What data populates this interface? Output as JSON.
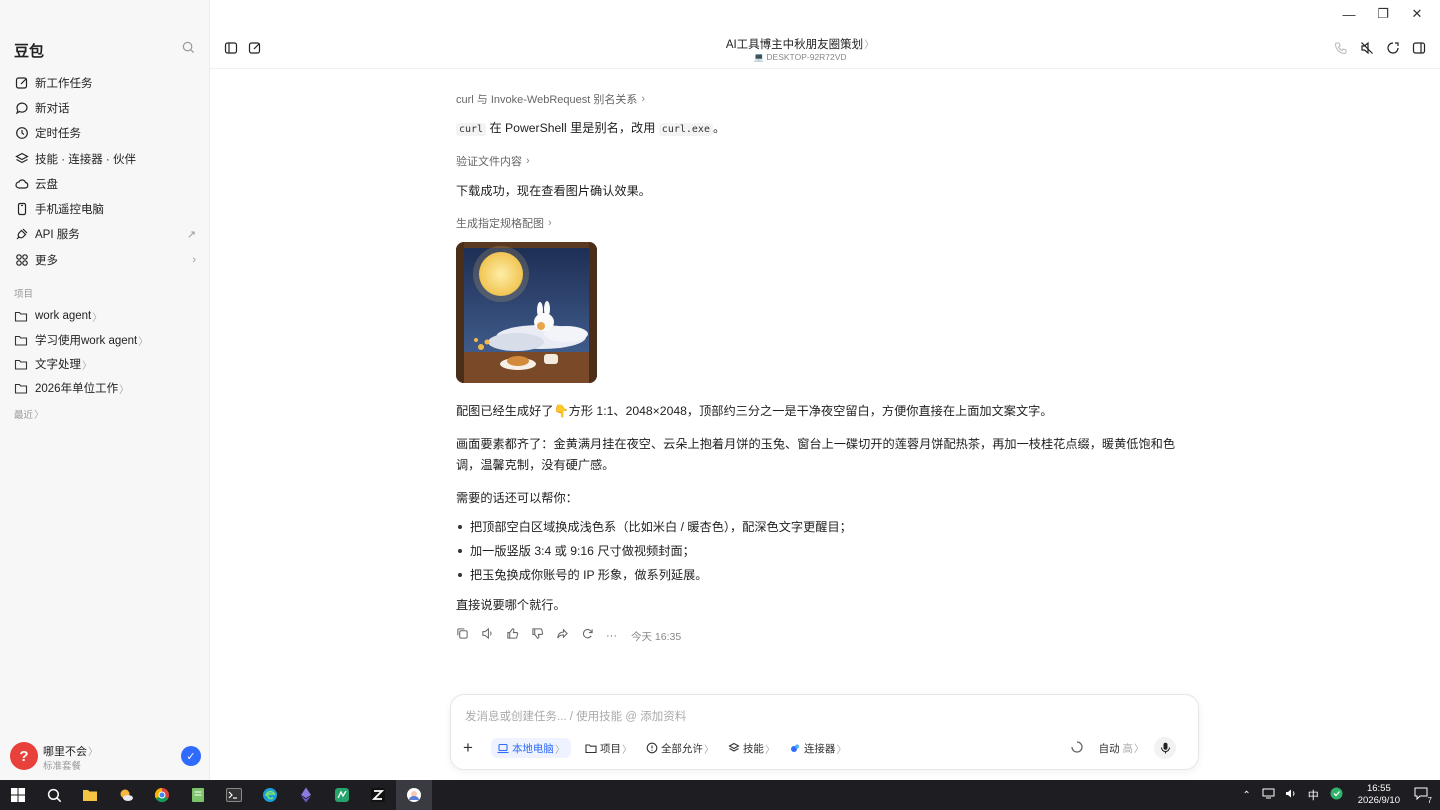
{
  "window": {
    "minimize": "—",
    "restore": "❐",
    "close": "✕"
  },
  "sidebar": {
    "brand": "豆包",
    "nav": [
      {
        "label": "新工作任务",
        "icon": "edit-icon"
      },
      {
        "label": "新对话",
        "icon": "chat-bubble-icon"
      },
      {
        "label": "定时任务",
        "icon": "clock-icon"
      },
      {
        "label": "技能 · 连接器 · 伙伴",
        "icon": "layers-icon"
      },
      {
        "label": "云盘",
        "icon": "cloud-icon"
      },
      {
        "label": "手机遥控电脑",
        "icon": "phone-icon"
      },
      {
        "label": "API 服务",
        "icon": "plug-icon",
        "tail": "↗"
      },
      {
        "label": "更多",
        "icon": "grid-icon",
        "tail": "›"
      }
    ],
    "projects_label": "项目",
    "projects": [
      {
        "label": "work agent"
      },
      {
        "label": "学习使用work agent"
      },
      {
        "label": "文字处理"
      },
      {
        "label": "2026年单位工作"
      }
    ],
    "recent_label": "最近",
    "user": {
      "avatar_letter": "?",
      "name": "哪里不会",
      "tier": "标准套餐",
      "badge": "✓"
    }
  },
  "topbar": {
    "title": "AI工具博主中秋朋友圈策划",
    "device": "DESKTOP-92R72VD"
  },
  "chat": {
    "step1": "curl 与 Invoke-WebRequest 别名关系",
    "msg1_code1": "curl",
    "msg1_text": " 在 PowerShell 里是别名，改用 ",
    "msg1_code2": "curl.exe",
    "msg1_end": "。",
    "step2": "验证文件内容",
    "msg2": "下载成功，现在查看图片确认效果。",
    "step3": "生成指定规格配图",
    "para1": "配图已经生成好了👇方形 1:1、2048×2048，顶部约三分之一是干净夜空留白，方便你直接在上面加文案文字。",
    "para2": "画面要素都齐了：金黄满月挂在夜空、云朵上抱着月饼的玉兔、窗台上一碟切开的莲蓉月饼配热茶，再加一枝桂花点缀，暖黄低饱和色调，温馨克制，没有硬广感。",
    "para3": "需要的话还可以帮你：",
    "bullets": [
      "把顶部空白区域换成浅色系（比如米白 / 暖杏色），配深色文字更醒目；",
      "加一版竖版 3:4 或 9:16 尺寸做视频封面；",
      "把玉兔换成你账号的 IP 形象，做系列延展。"
    ],
    "para4": "直接说要哪个就行。",
    "more": "···",
    "timestamp": "今天 16:35"
  },
  "composer": {
    "placeholder": "发消息或创建任务... / 使用技能 @ 添加资料",
    "plus": "+",
    "pills": [
      "本地电脑",
      "项目",
      "全部允许",
      "技能",
      "连接器"
    ],
    "mode": "自动",
    "mode_level": "高"
  },
  "taskbar": {
    "ime": "中",
    "time": "16:55",
    "date": "2026/9/10",
    "notify": "7"
  },
  "colors": {
    "accent": "#2f6bff",
    "avatar": "#e8413b",
    "taskbar": "#1d1d22"
  }
}
